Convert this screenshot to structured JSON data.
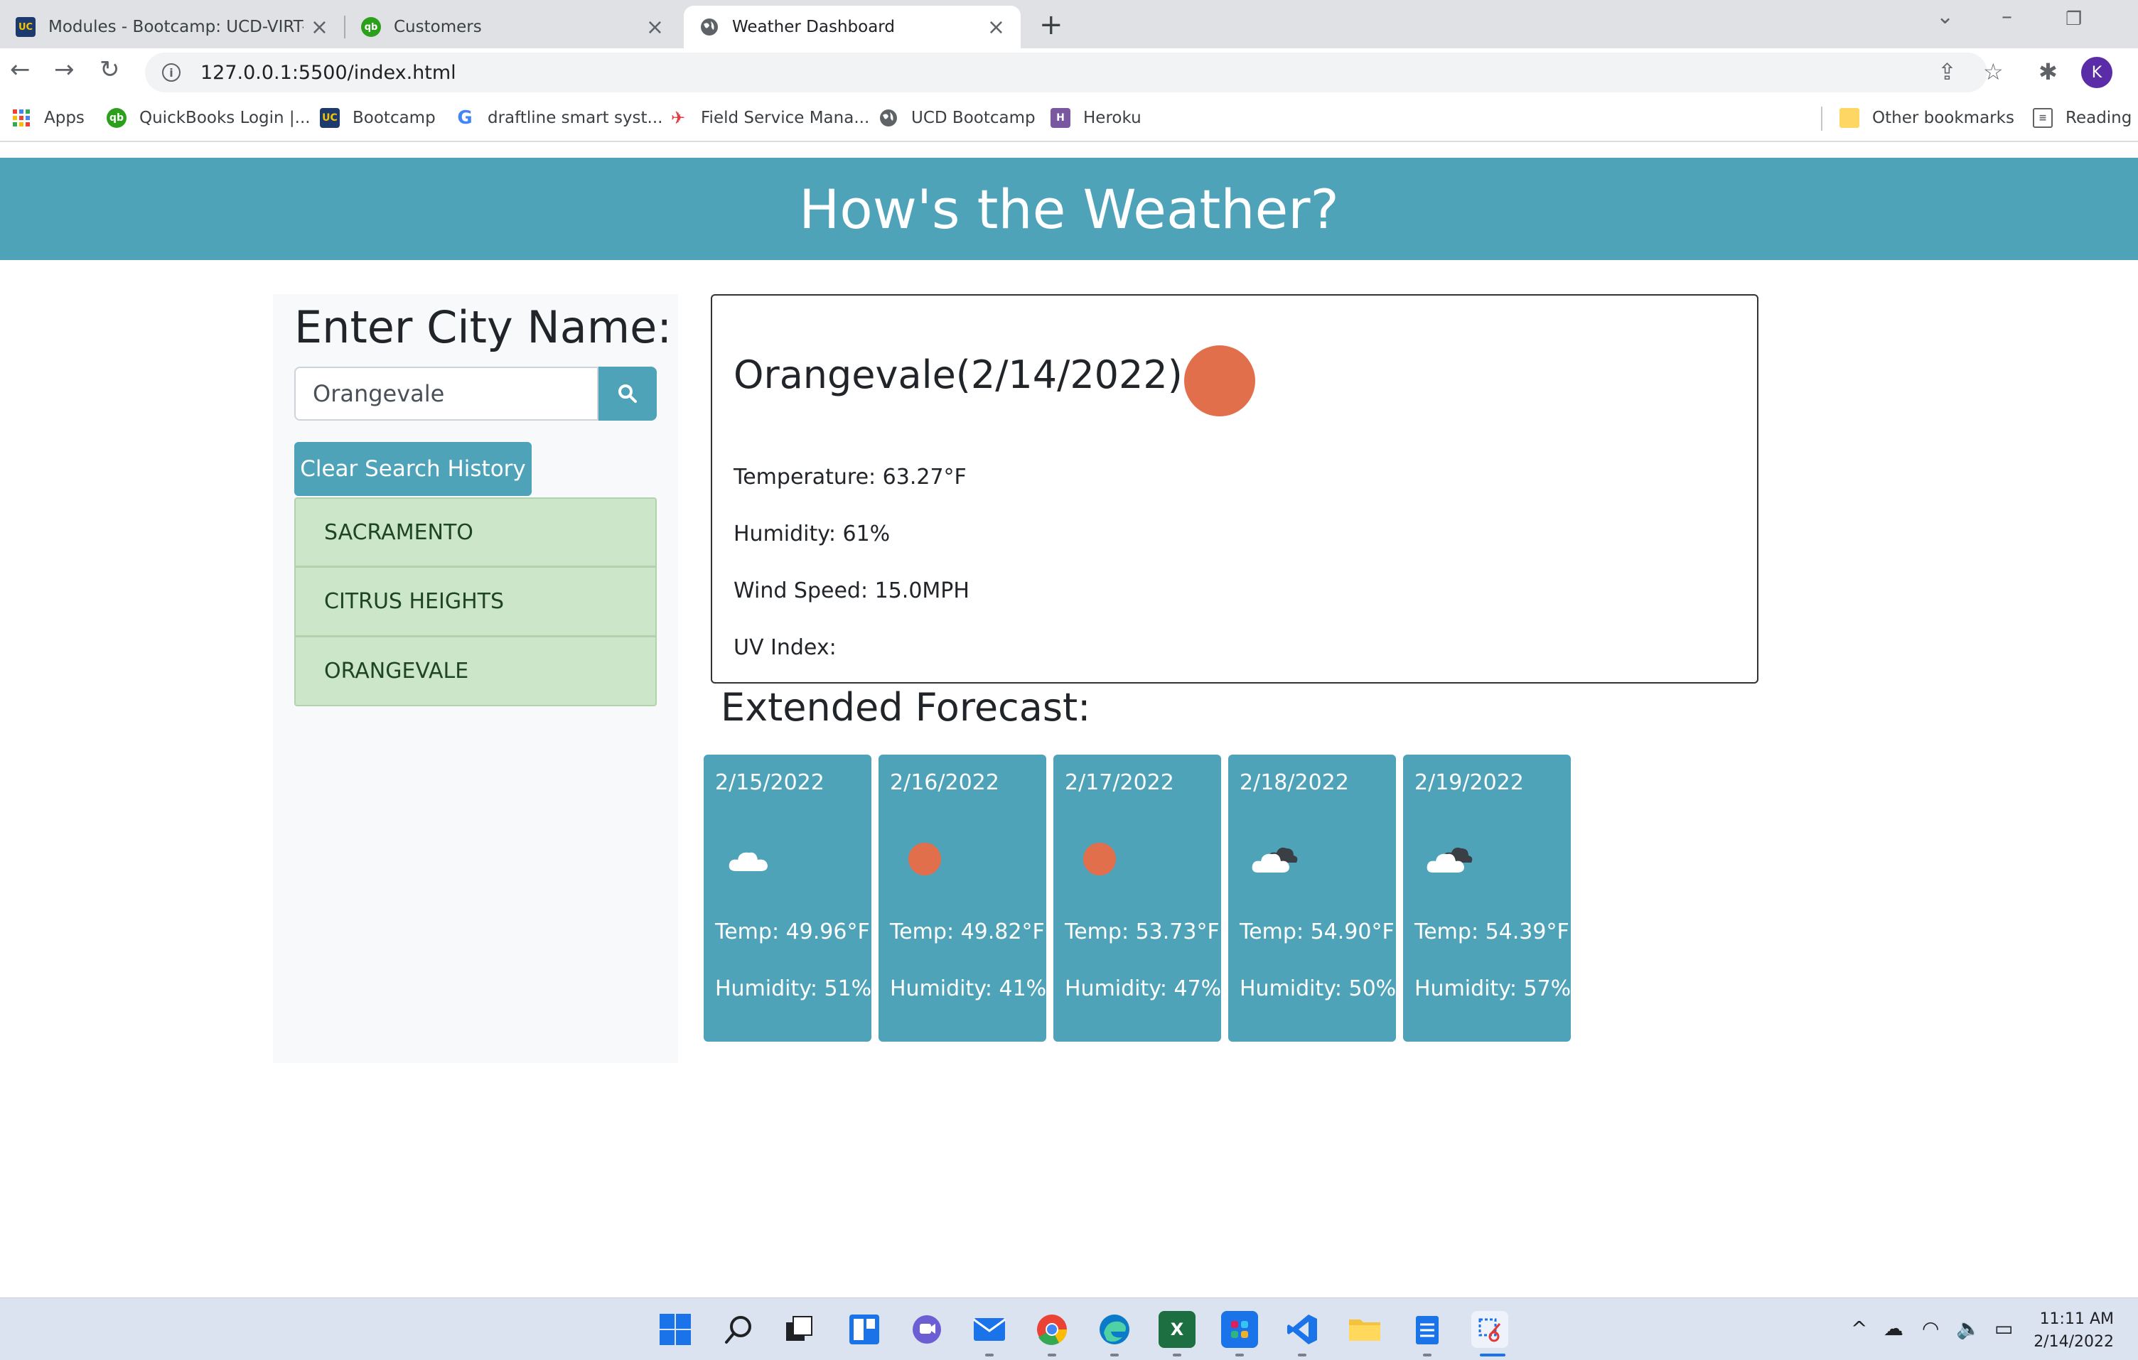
{
  "browser": {
    "tabs": [
      {
        "title": "Modules - Bootcamp: UCD-VIRT-",
        "favicon": "uc-davis-icon",
        "active": false
      },
      {
        "title": "Customers",
        "favicon": "quickbooks-icon",
        "active": false
      },
      {
        "title": "Weather Dashboard",
        "favicon": "globe-icon",
        "active": true
      }
    ],
    "url": "127.0.0.1:5500/index.html",
    "profile_initial": "K",
    "bookmarks": [
      {
        "label": "Apps",
        "icon": "apps-grid-icon"
      },
      {
        "label": "QuickBooks Login |...",
        "icon": "quickbooks-icon"
      },
      {
        "label": "Bootcamp",
        "icon": "uc-davis-icon"
      },
      {
        "label": "draftline smart syst...",
        "icon": "google-icon"
      },
      {
        "label": "Field Service Mana...",
        "icon": "field-service-icon"
      },
      {
        "label": "UCD Bootcamp",
        "icon": "globe-icon"
      },
      {
        "label": "Heroku",
        "icon": "heroku-icon"
      }
    ],
    "other_bookmarks": "Other bookmarks",
    "reading_list": "Reading l"
  },
  "page": {
    "title": "How's the Weather?",
    "search": {
      "label": "Enter City Name:",
      "value": "Orangevale",
      "clear_label": "Clear Search History"
    },
    "history": [
      "SACRAMENTO",
      "CITRUS HEIGHTS",
      "ORANGEVALE"
    ],
    "current": {
      "heading": "Orangevale(2/14/2022)",
      "icon": "sun-icon",
      "temperature": "Temperature: 63.27°F",
      "humidity": "Humidity: 61%",
      "wind": "Wind Speed: 15.0MPH",
      "uv": "UV Index:"
    },
    "forecast_title": "Extended Forecast:",
    "forecast": [
      {
        "date": "2/15/2022",
        "icon": "cloud-icon",
        "temp": "Temp: 49.96°F",
        "humidity": "Humidity: 51%"
      },
      {
        "date": "2/16/2022",
        "icon": "sun-icon",
        "temp": "Temp: 49.82°F",
        "humidity": "Humidity: 41%"
      },
      {
        "date": "2/17/2022",
        "icon": "sun-icon",
        "temp": "Temp: 53.73°F",
        "humidity": "Humidity: 47%"
      },
      {
        "date": "2/18/2022",
        "icon": "broken-clouds-icon",
        "temp": "Temp: 54.90°F",
        "humidity": "Humidity: 50%"
      },
      {
        "date": "2/19/2022",
        "icon": "broken-clouds-icon",
        "temp": "Temp: 54.39°F",
        "humidity": "Humidity: 57%"
      }
    ]
  },
  "taskbar": {
    "time": "11:11 AM",
    "date": "2/14/2022"
  },
  "colors": {
    "brand": "#4fa3b9",
    "sun": "#e26f4c",
    "history_bg": "#cce6c9"
  }
}
